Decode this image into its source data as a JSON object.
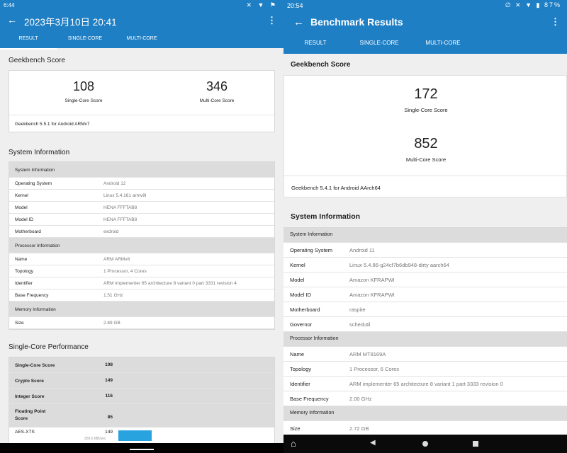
{
  "left": {
    "status": {
      "time": "6:44",
      "icons": "✕ ▼ ⚑"
    },
    "appbar": {
      "title": "2023年3月10日 20:41",
      "back": "←",
      "menu": "⋮"
    },
    "tabs": [
      "RESULT",
      "SINGLE-CORE",
      "MULTI-CORE"
    ],
    "score_section": "Geekbench Score",
    "single_score": "108",
    "single_label": "Single-Core Score",
    "multi_score": "346",
    "multi_label": "Multi-Core Score",
    "version": "Geekbench 5.5.1 for Android ARMv7",
    "sys_section": "System Information",
    "sys_rows": [
      {
        "k": "System Information",
        "v": "",
        "head": true
      },
      {
        "k": "Operating System",
        "v": "Android 12"
      },
      {
        "k": "Kernel",
        "v": "Linux 5.4.161 armv8l"
      },
      {
        "k": "Model",
        "v": "HENA FFFTAB8"
      },
      {
        "k": "Model ID",
        "v": "HENA FFFTAB8"
      },
      {
        "k": "Motherboard",
        "v": "exdroid"
      },
      {
        "k": "Processor Information",
        "v": "",
        "head": true
      },
      {
        "k": "Name",
        "v": "ARM ARMv8"
      },
      {
        "k": "Topology",
        "v": "1 Processor, 4 Cores"
      },
      {
        "k": "Identifier",
        "v": "ARM implementer 65 architecture 8 variant 0 part 3331 revision 4"
      },
      {
        "k": "Base Frequency",
        "v": "1.51 GHz"
      },
      {
        "k": "Memory Information",
        "v": "",
        "head": true
      },
      {
        "k": "Size",
        "v": "2.89 GB"
      }
    ],
    "perf_section": "Single-Core Performance",
    "perf_rows": [
      {
        "k": "Single-Core Score",
        "n": "108"
      },
      {
        "k": "Crypto Score",
        "n": "149"
      },
      {
        "k": "Integer Score",
        "n": "116"
      },
      {
        "k": "Floating Point\nScore",
        "n": "85"
      }
    ],
    "aes": {
      "k": "AES-XTS",
      "n": "149",
      "sub": "259.6 MB/sec"
    }
  },
  "right": {
    "status": {
      "time": "20:54",
      "icons": "∅ ✕ ▼ ▮",
      "battery": "87%"
    },
    "appbar": {
      "title": "Benchmark Results",
      "back": "←",
      "menu": "⋮"
    },
    "tabs": [
      "RESULT",
      "SINGLE-CORE",
      "MULTI-CORE"
    ],
    "score_section": "Geekbench Score",
    "single_score": "172",
    "single_label": "Single-Core Score",
    "multi_score": "852",
    "multi_label": "Multi-Core Score",
    "version": "Geekbench 5.4.1 for Android AArch64",
    "sys_section": "System Information",
    "sys_rows": [
      {
        "k": "System Information",
        "v": "",
        "head": true
      },
      {
        "k": "Operating System",
        "v": "Android 11"
      },
      {
        "k": "Kernel",
        "v": "Linux 5.4.86-g24cf7b6db948-dirty aarch64"
      },
      {
        "k": "Model",
        "v": "Amazon KFRAPWI"
      },
      {
        "k": "Model ID",
        "v": "Amazon KFRAPWI"
      },
      {
        "k": "Motherboard",
        "v": "raspite"
      },
      {
        "k": "Governor",
        "v": "schedutil"
      },
      {
        "k": "Processor Information",
        "v": "",
        "head": true
      },
      {
        "k": "Name",
        "v": "ARM MT8169A"
      },
      {
        "k": "Topology",
        "v": "1 Processor, 6 Cores"
      },
      {
        "k": "Identifier",
        "v": "ARM implementer 65 architecture 8 variant 1 part 3333 revision 0"
      },
      {
        "k": "Base Frequency",
        "v": "2.00 GHz"
      },
      {
        "k": "Memory Information",
        "v": "",
        "head": true
      },
      {
        "k": "Size",
        "v": "2.72 GB"
      }
    ],
    "nav": {
      "home": "⌂",
      "back": "◀"
    }
  },
  "colors": {
    "accent": "#1f7fc4",
    "bar": "#29a3e0"
  }
}
